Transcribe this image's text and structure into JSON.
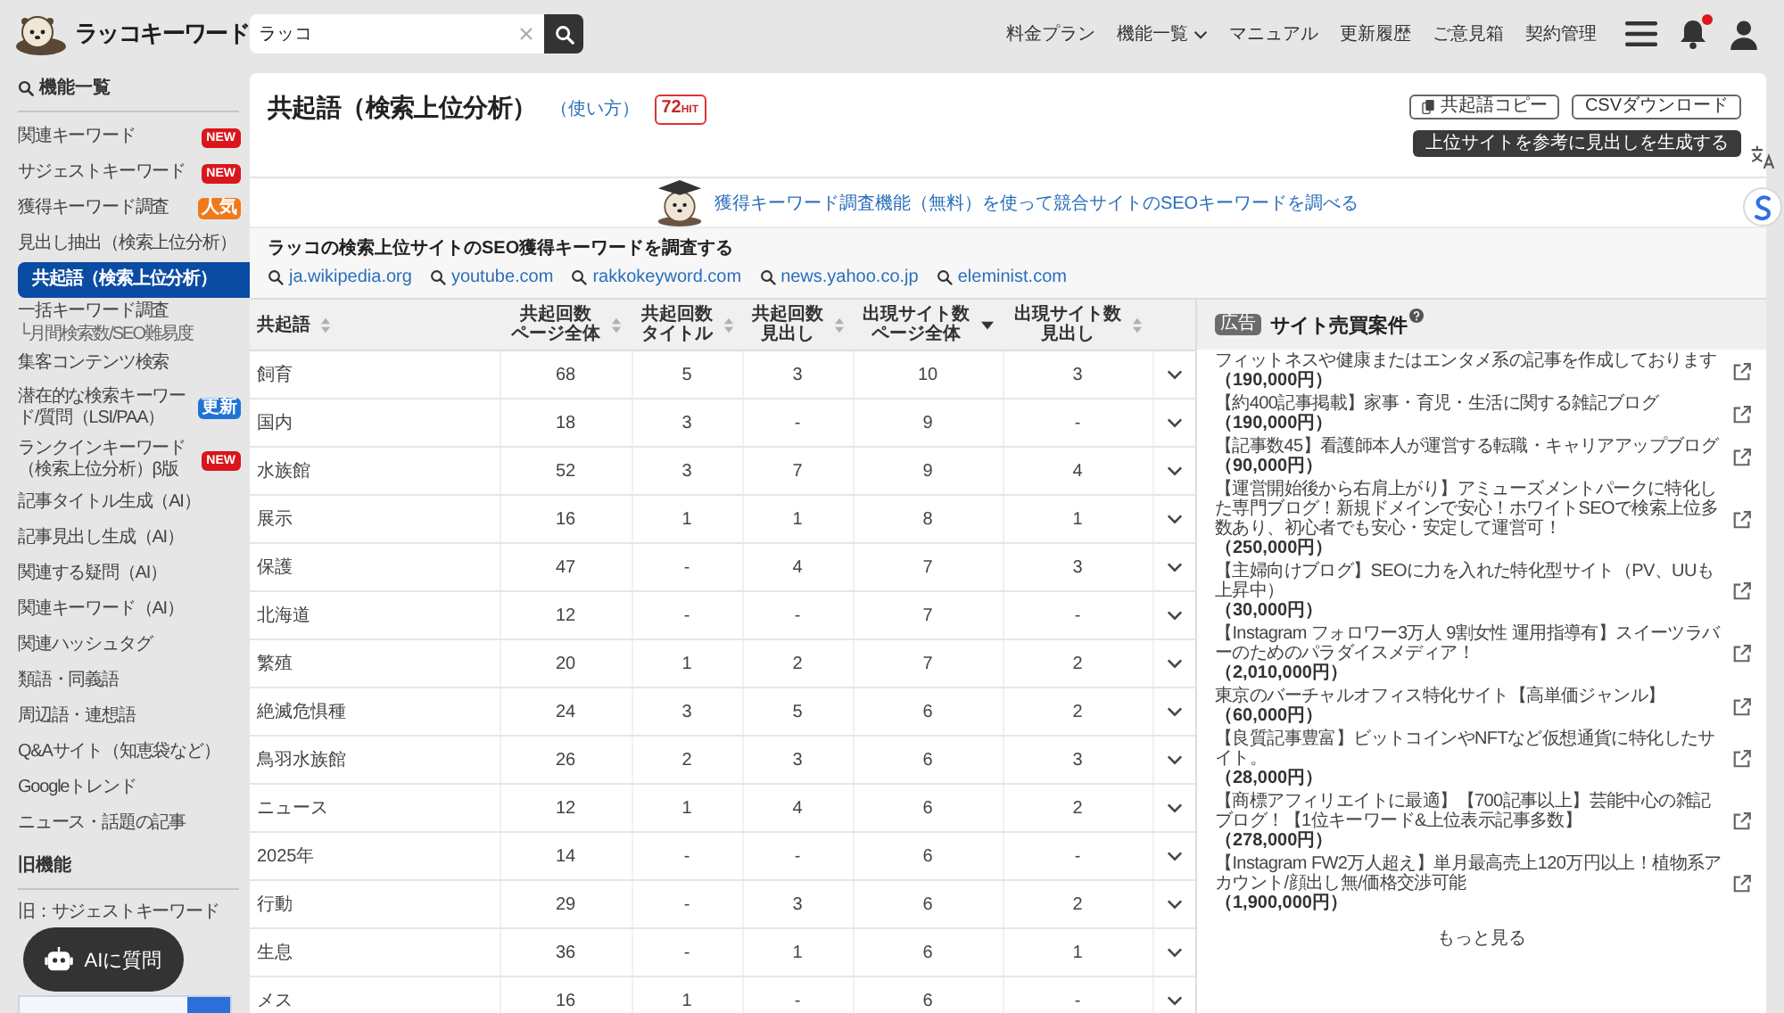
{
  "logo": {
    "text": "ラッコキーワード"
  },
  "search": {
    "value": "ラッコ"
  },
  "nav": [
    {
      "label": "料金プラン",
      "dropdown": false
    },
    {
      "label": "機能一覧",
      "dropdown": true
    },
    {
      "label": "マニュアル",
      "dropdown": false
    },
    {
      "label": "更新履歴",
      "dropdown": false
    },
    {
      "label": "ご意見箱",
      "dropdown": false
    },
    {
      "label": "契約管理",
      "dropdown": false
    }
  ],
  "notifications": {
    "unread": true
  },
  "sidebar": {
    "heading": "機能一覧",
    "items": [
      {
        "label": "関連キーワード",
        "selected": false,
        "badge": {
          "text": "NEW",
          "color": "#d9161c"
        }
      },
      {
        "label": "サジェストキーワード",
        "selected": false,
        "badge": {
          "text": "NEW",
          "color": "#d9161c"
        }
      },
      {
        "label": "獲得キーワード調査",
        "selected": false,
        "badge": {
          "text": "人気",
          "color": "#ee7a1c"
        }
      },
      {
        "label": "見出し抽出（検索上位分析）",
        "selected": false
      },
      {
        "label": "共起語（検索上位分析）",
        "selected": true
      },
      {
        "label": "一括キーワード調査",
        "sub": "└月間検索数/SEO難易度",
        "selected": false
      },
      {
        "label": "集客コンテンツ検索",
        "selected": false
      },
      {
        "label": "潜在的な検索キーワード/質問（LSI/PAA）",
        "selected": false,
        "badge": {
          "text": "更新",
          "color": "#1f73d6"
        }
      },
      {
        "label": "ランクインキーワード（検索上位分析）β版",
        "selected": false,
        "badge": {
          "text": "NEW",
          "color": "#d9161c"
        }
      },
      {
        "label": "記事タイトル生成（AI）",
        "selected": false
      },
      {
        "label": "記事見出し生成（AI）",
        "selected": false
      },
      {
        "label": "関連する疑問（AI）",
        "selected": false
      },
      {
        "label": "関連キーワード（AI）",
        "selected": false
      },
      {
        "label": "関連ハッシュタグ",
        "selected": false
      },
      {
        "label": "類語・同義語",
        "selected": false
      },
      {
        "label": "周辺語・連想語",
        "selected": false
      },
      {
        "label": "Q&Aサイト（知恵袋など）",
        "selected": false
      },
      {
        "label": "Googleトレンド",
        "selected": false
      },
      {
        "label": "ニュース・話題の記事",
        "selected": false
      }
    ],
    "legacy_heading": "旧機能",
    "legacy_items": [
      {
        "label": "旧：サジェストキーワード",
        "selected": false
      }
    ]
  },
  "ai_button": {
    "label": "AIに質問"
  },
  "page": {
    "title": "共起語（検索上位分析）",
    "help_link": "（使い方）",
    "hit_count": "72",
    "hit_unit": "HIT",
    "buttons": [
      {
        "label": "共起語コピー",
        "kind": "copy"
      },
      {
        "label": "CSVダウンロード",
        "kind": "download"
      },
      {
        "label": "上位サイトを参考に見出しを生成する",
        "kind": "generate"
      }
    ]
  },
  "banner": {
    "link": "獲得キーワード調査機能（無料）を使って競合サイトのSEOキーワードを調べる"
  },
  "competitors": {
    "heading": "ラッコの検索上位サイトのSEO獲得キーワードを調査する",
    "sites": [
      "ja.wikipedia.org",
      "youtube.com",
      "rakkokeyword.com",
      "news.yahoo.co.jp",
      "eleminist.com"
    ]
  },
  "table": {
    "columns": [
      {
        "lines": [
          "共起語"
        ],
        "sorted": false
      },
      {
        "lines": [
          "共起回数",
          "ページ全体"
        ],
        "sorted": false
      },
      {
        "lines": [
          "共起回数",
          "タイトル"
        ],
        "sorted": false
      },
      {
        "lines": [
          "共起回数",
          "見出し"
        ],
        "sorted": false
      },
      {
        "lines": [
          "出現サイト数",
          "ページ全体"
        ],
        "sorted": true
      },
      {
        "lines": [
          "出現サイト数",
          "見出し"
        ],
        "sorted": false
      }
    ],
    "rows": [
      [
        "飼育",
        "68",
        "5",
        "3",
        "10",
        "3"
      ],
      [
        "国内",
        "18",
        "3",
        "-",
        "9",
        "-"
      ],
      [
        "水族館",
        "52",
        "3",
        "7",
        "9",
        "4"
      ],
      [
        "展示",
        "16",
        "1",
        "1",
        "8",
        "1"
      ],
      [
        "保護",
        "47",
        "-",
        "4",
        "7",
        "3"
      ],
      [
        "北海道",
        "12",
        "-",
        "-",
        "7",
        "-"
      ],
      [
        "繁殖",
        "20",
        "1",
        "2",
        "7",
        "2"
      ],
      [
        "絶滅危惧種",
        "24",
        "3",
        "5",
        "6",
        "2"
      ],
      [
        "鳥羽水族館",
        "26",
        "2",
        "3",
        "6",
        "3"
      ],
      [
        "ニュース",
        "12",
        "1",
        "4",
        "6",
        "2"
      ],
      [
        "2025年",
        "14",
        "-",
        "-",
        "6",
        "-"
      ],
      [
        "行動",
        "29",
        "-",
        "3",
        "6",
        "2"
      ],
      [
        "生息",
        "36",
        "-",
        "1",
        "6",
        "1"
      ],
      [
        "メス",
        "16",
        "1",
        "-",
        "6",
        "-"
      ]
    ]
  },
  "ads": {
    "badge": "広告",
    "title": "サイト売買案件",
    "items": [
      {
        "text": "フィットネスや健康またはエンタメ系の記事を作成しております",
        "price": "（190,000円）"
      },
      {
        "text": "【約400記事掲載】家事・育児・生活に関する雑記ブログ",
        "price": "（190,000円）"
      },
      {
        "text": "【記事数45】看護師本人が運営する転職・キャリアアップブログ",
        "price": "（90,000円）"
      },
      {
        "text": "【運営開始後から右肩上がり】アミューズメントパークに特化した専門ブログ！新規ドメインで安心！ホワイトSEOで検索上位多数あり、初心者でも安心・安定して運営可！",
        "price": "（250,000円）"
      },
      {
        "text": "【主婦向けブログ】SEOに力を入れた特化型サイト（PV、UUも上昇中）",
        "price": "（30,000円）"
      },
      {
        "text": "【Instagram フォロワー3万人 9割女性 運用指導有】スイーツラバーのためのパラダイスメディア！",
        "price": "（2,010,000円）"
      },
      {
        "text": "東京のバーチャルオフィス特化サイト【高単価ジャンル】",
        "price": "（60,000円）"
      },
      {
        "text": "【良質記事豊富】ビットコインやNFTなど仮想通貨に特化したサイト。",
        "price": "（28,000円）"
      },
      {
        "text": "【商標アフィリエイトに最適】【700記事以上】芸能中心の雑記ブログ！【1位キーワード&上位表示記事多数】",
        "price": "（278,000円）"
      },
      {
        "text": "【Instagram FW2万人超え】単月最高売上120万円以上！植物系アカウント/顔出し無/価格交渉可能",
        "price": "（1,900,000円）"
      }
    ],
    "more": "もっと見る"
  }
}
